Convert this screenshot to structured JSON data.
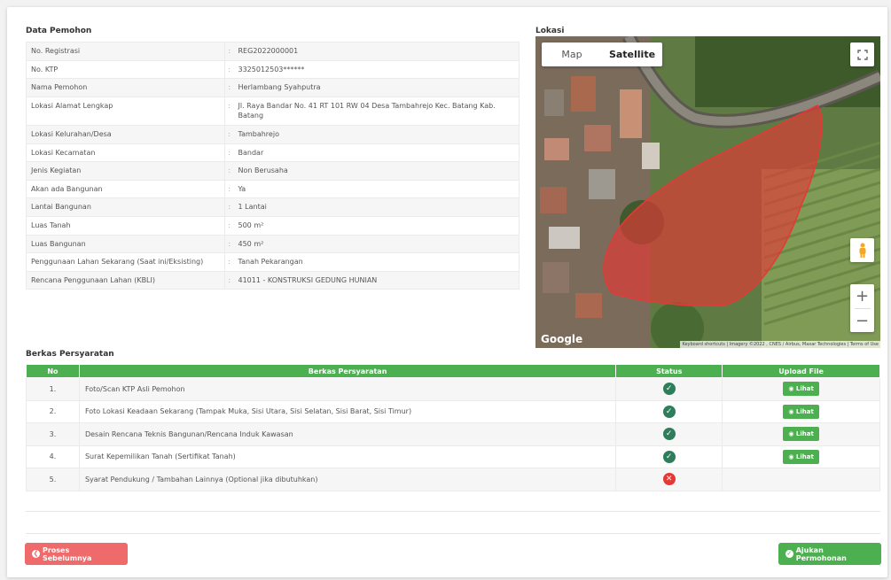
{
  "data_pemohon": {
    "title": "Data Pemohon",
    "rows": [
      {
        "label": "No. Registrasi",
        "value": "REG2022000001"
      },
      {
        "label": "No. KTP",
        "value": "3325012503******"
      },
      {
        "label": "Nama Pemohon",
        "value": "Herlambang Syahputra"
      },
      {
        "label": "Lokasi Alamat Lengkap",
        "value": "Jl. Raya Bandar No. 41 RT 101 RW 04 Desa Tambahrejo Kec. Batang Kab. Batang"
      },
      {
        "label": "Lokasi Kelurahan/Desa",
        "value": "Tambahrejo"
      },
      {
        "label": "Lokasi Kecamatan",
        "value": "Bandar"
      },
      {
        "label": "Jenis Kegiatan",
        "value": "Non Berusaha"
      },
      {
        "label": "Akan ada Bangunan",
        "value": "Ya"
      },
      {
        "label": "Lantai Bangunan",
        "value": "1 Lantai"
      },
      {
        "label": "Luas Tanah",
        "value": "500 m²"
      },
      {
        "label": "Luas Bangunan",
        "value": "450 m²"
      },
      {
        "label": "Penggunaan Lahan Sekarang (Saat ini/Eksisting)",
        "value": "Tanah Pekarangan"
      },
      {
        "label": "Rencana Penggunaan Lahan (KBLI)",
        "value": "41011 - KONSTRUKSI GEDUNG HUNIAN"
      }
    ],
    "separator": ":"
  },
  "lokasi": {
    "title": "Lokasi",
    "tab_map": "Map",
    "tab_satellite": "Satellite",
    "google": "Google",
    "attribution": "Keyboard shortcuts | Imagery ©2022 , CNES / Airbus, Maxar Technologies | Terms of Use",
    "zoom_in": "+",
    "zoom_out": "−"
  },
  "berkas": {
    "title": "Berkas Persyaratan",
    "headers": {
      "no": "No",
      "berkas": "Berkas Persyaratan",
      "status": "Status",
      "upload": "Upload File"
    },
    "rows": [
      {
        "no": "1.",
        "name": "Foto/Scan KTP Asli Pemohon",
        "status": "ok",
        "upload": "Lihat"
      },
      {
        "no": "2.",
        "name": "Foto Lokasi Keadaan Sekarang (Tampak Muka, Sisi Utara, Sisi Selatan, Sisi Barat, Sisi Timur)",
        "status": "ok",
        "upload": "Lihat"
      },
      {
        "no": "3.",
        "name": "Desain Rencana Teknis Bangunan/Rencana Induk Kawasan",
        "status": "ok",
        "upload": "Lihat"
      },
      {
        "no": "4.",
        "name": "Surat Kepemilikan Tanah (Sertifikat Tanah)",
        "status": "ok",
        "upload": "Lihat"
      },
      {
        "no": "5.",
        "name": "Syarat Pendukung / Tambahan Lainnya (Optional jika dibutuhkan)",
        "status": "missing",
        "upload": ""
      }
    ]
  },
  "actions": {
    "prev": "Proses Sebelumnya",
    "submit": "Ajukan Permohonan"
  },
  "colors": {
    "accent": "#4caf50",
    "danger": "#ef6a6a",
    "ok": "#2e7d5b"
  }
}
